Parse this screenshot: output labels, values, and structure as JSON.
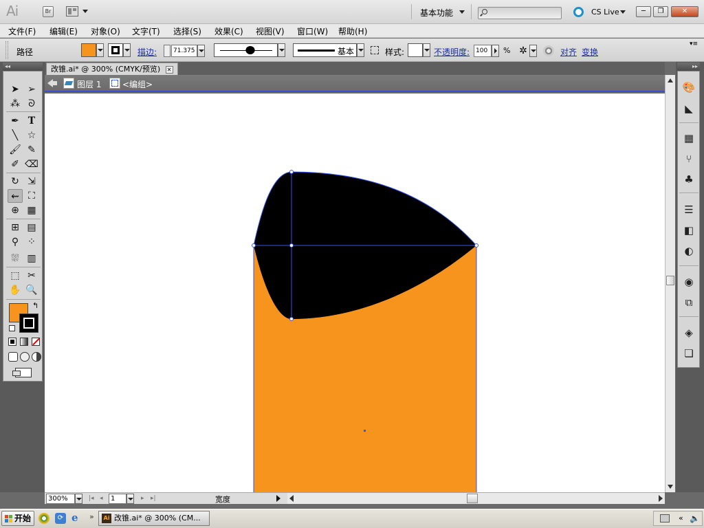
{
  "app": {
    "logo": "Ai",
    "bridge_label": "Br",
    "workspace": "基本功能",
    "search_placeholder": "",
    "cslive": "CS Live",
    "window_buttons": {
      "minimize": "─",
      "restore": "❐",
      "close": "✕"
    }
  },
  "menu": [
    "文件(F)",
    "编辑(E)",
    "对象(O)",
    "文字(T)",
    "选择(S)",
    "效果(C)",
    "视图(V)",
    "窗口(W)",
    "帮助(H)"
  ],
  "control": {
    "selection_type": "路径",
    "fill_color": "#f7941d",
    "stroke_label": "描边:",
    "stroke_weight": "71.375",
    "profile_label": "基本",
    "style_label": "样式:",
    "opacity_label": "不透明度:",
    "opacity_value": "100",
    "opacity_unit": "%",
    "align_label": "对齐",
    "transform_label": "变换"
  },
  "document": {
    "tab_title": "改锥.ai* @ 300% (CMYK/预览)",
    "layer": "图层 1",
    "group": "<编组>",
    "fill_color": "#f7941d",
    "shape_color": "#000000",
    "selection_color": "#3355ee"
  },
  "status": {
    "zoom": "300%",
    "artboard": "1",
    "status_label": "宽度"
  },
  "taskbar": {
    "start": "开始",
    "task_label": "改锥.ai* @ 300% (CM..."
  }
}
